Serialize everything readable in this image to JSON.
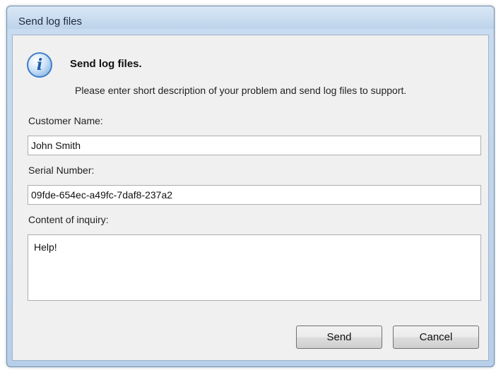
{
  "window": {
    "title": "Send log files"
  },
  "message": {
    "icon": "info-icon",
    "icon_glyph": "i",
    "heading": "Send log files.",
    "description": "Please enter short description of your problem and send log files to support."
  },
  "form": {
    "customer_name_label": "Customer Name:",
    "customer_name_value": "John Smith",
    "serial_number_label": "Serial Number:",
    "serial_number_value": "09fde-654ec-a49fc-7daf8-237a2",
    "inquiry_label": "Content of inquiry:",
    "inquiry_value": "Help!"
  },
  "buttons": {
    "send_label": "Send",
    "cancel_label": "Cancel"
  },
  "colors": {
    "accent": "#3f7fc4",
    "window_frame": "#b7cfe8",
    "client_background": "#f0f0f0"
  }
}
